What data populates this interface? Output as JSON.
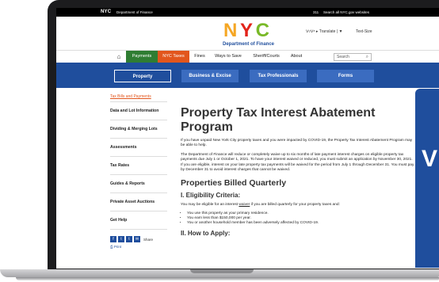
{
  "topbar": {
    "logo": "NYC",
    "department": "Department of Finance",
    "link_311": "311",
    "search_all": "Search all NYC.gov websites"
  },
  "header": {
    "logo_letters": [
      "N",
      "Y",
      "C"
    ],
    "department_label": "Department of Finance",
    "translate": "ᐯ▿ᐯ⁸ ▸ Translate | ▼",
    "text_size": "Text-Size"
  },
  "nav": {
    "items": [
      "Payments",
      "NYC Taxes",
      "Fines",
      "Ways to Save",
      "Sheriff/Courts",
      "About"
    ],
    "search_placeholder": "Search"
  },
  "subnav": {
    "tabs": [
      "Property",
      "Business & Excise",
      "Tax Professionals",
      "Forms"
    ]
  },
  "sidebar": {
    "active_link": "Tax Bills and Payments",
    "items": [
      "Data and Lot Information",
      "Dividing & Merging Lots",
      "Assessments",
      "Tax Rates",
      "Guides & Reports",
      "Private Asset Auctions",
      "Get Help"
    ],
    "share_label": "Share",
    "print_label": "Print"
  },
  "content": {
    "title": "Property Tax Interest Abatement Program",
    "intro": "If you have unpaid New York City property taxes and you were impacted by COVID-19, the Property Tax Interest Abatement Program may be able to help.",
    "para2": "The Department of Finance will reduce or completely waive up to six months of late payment interest charges on eligible property tax payments due July 1 or October 1, 2021. To have your interest waived or reduced, you must submit an application by November 30, 2021. If you are eligible, interest on your late property tax payments will be waived for the period from July 1 through December 31. You must pay by December 31 to avoid interest charges that cannot be waived.",
    "h2": "Properties Billed Quarterly",
    "h3": "I. Eligibility Criteria:",
    "elig_before": "You may be eligible for an interest ",
    "elig_link": "waiver",
    "elig_after": " if you are billed quarterly for your property taxes and:",
    "bullets": [
      "You use this property as your primary residence.",
      "You earn less than $150,000 per year.",
      "You or another household member has been adversely affected by COVID-19."
    ],
    "h3b": "II. How to Apply:"
  },
  "panel": {
    "letter": "V"
  }
}
